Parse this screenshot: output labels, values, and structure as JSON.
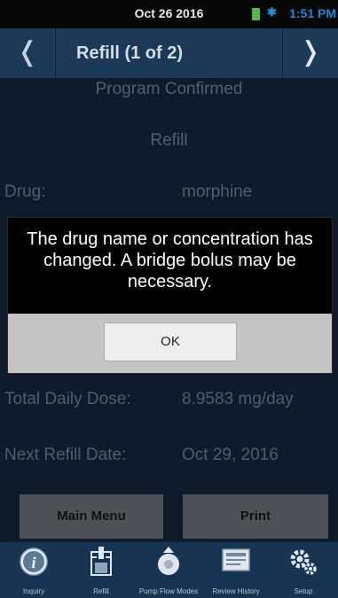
{
  "status_bar": {
    "date": "Oct 26 2016",
    "time": "1:51 PM"
  },
  "header": {
    "title": "Refill (1 of 2)",
    "prev_icon": "chevron-left-icon",
    "next_icon": "chevron-right-icon"
  },
  "content": {
    "heading": "Program Confirmed",
    "subheading": "Refill",
    "rows": [
      {
        "label": "Drug:",
        "value": "morphine"
      },
      {
        "label": "Total Daily Dose:",
        "value": "8.9583 mg/day"
      },
      {
        "label": "Next Refill Date:",
        "value": "Oct 29, 2016"
      }
    ]
  },
  "dialog": {
    "message": "The drug name or concentration has changed. A bridge bolus may be necessary.",
    "ok_label": "OK"
  },
  "actions": {
    "main_menu_label": "Main Menu",
    "print_label": "Print"
  },
  "tabs": [
    {
      "label": "Inquiry",
      "icon": "info-icon"
    },
    {
      "label": "Refill",
      "icon": "refill-icon"
    },
    {
      "label": "Pump Flow Modes",
      "icon": "pump-icon"
    },
    {
      "label": "Review History",
      "icon": "history-icon"
    },
    {
      "label": "Setup",
      "icon": "gear-icon"
    }
  ]
}
